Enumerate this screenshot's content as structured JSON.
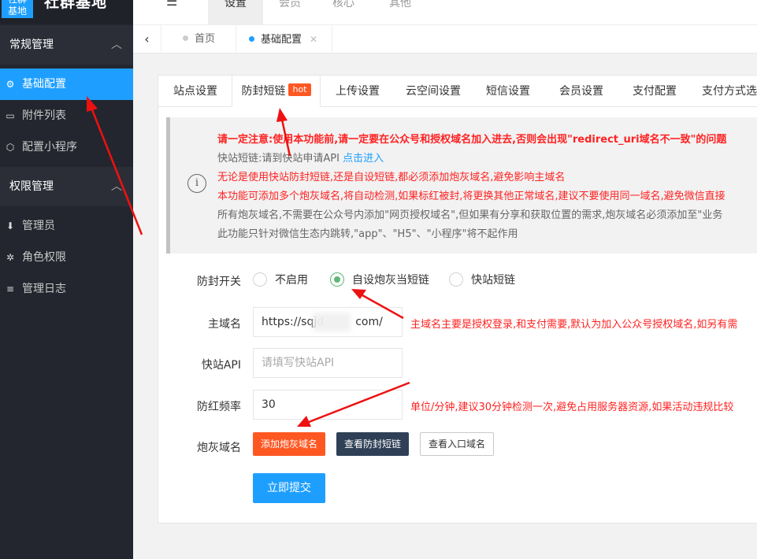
{
  "app": {
    "logo_badge_line1": "社群",
    "logo_badge_line2": "基地",
    "title": "社群基地"
  },
  "topbar": {
    "tabs": [
      {
        "label": "设置"
      },
      {
        "label": "会员"
      },
      {
        "label": "核心"
      },
      {
        "label": "其他"
      }
    ]
  },
  "sidebar": {
    "group1": "常规管理",
    "items1": [
      {
        "label": "基础配置"
      },
      {
        "label": "附件列表"
      },
      {
        "label": "配置小程序"
      }
    ],
    "group2": "权限管理",
    "items2": [
      {
        "label": "管理员"
      },
      {
        "label": "角色权限"
      },
      {
        "label": "管理日志"
      }
    ]
  },
  "pagetabs": [
    {
      "label": "首页"
    },
    {
      "label": "基础配置"
    }
  ],
  "form_tabs": [
    {
      "label": "站点设置"
    },
    {
      "label": "防封短链"
    },
    {
      "label": "上传设置"
    },
    {
      "label": "云空间设置"
    },
    {
      "label": "短信设置"
    },
    {
      "label": "会员设置"
    },
    {
      "label": "支付配置"
    },
    {
      "label": "支付方式选"
    }
  ],
  "hot_badge": "hot",
  "notice": {
    "line1": "请一定注意:使用本功能前,请一定要在公众号和授权域名加入进去,否则会出现\"redirect_uri域名不一致\"的问题",
    "line2_prefix": "快站短链:请到快站申请API ",
    "line2_link": "点击进入",
    "line3": "无论是使用快站防封短链,还是自设短链,都必须添加炮灰域名,避免影响主域名",
    "line4": "本功能可添加多个炮灰域名,将自动检测,如果标红被封,将更换其他正常域名,建议不要使用同一域名,避免微信直接",
    "line5": "所有炮灰域名,不需要在公众号内添加\"网页授权域名\",但如果有分享和获取位置的需求,炮灰域名必须添加至\"业务",
    "line6": "此功能只针对微信生态内跳转,\"app\"、\"H5\"、\"小程序\"将不起作用"
  },
  "form": {
    "switch_label": "防封开关",
    "radio_options": [
      {
        "label": "不启用",
        "checked": false
      },
      {
        "label": "自设炮灰当短链",
        "checked": true
      },
      {
        "label": "快站短链",
        "checked": false
      }
    ],
    "domain_label": "主域名",
    "domain_value": "https://sqjd         com/",
    "domain_tip": "主域名主要是授权登录,和支付需要,默认为加入公众号授权域名,如另有需",
    "api_label": "快站API",
    "api_placeholder": "请填写快站API",
    "freq_label": "防红频率",
    "freq_value": "30",
    "freq_tip": "单位/分钟,建议30分钟检测一次,避免占用服务器资源,如果活动违规比较",
    "cannon_label": "炮灰域名",
    "btn_add": "添加炮灰域名",
    "btn_view_links": "查看防封短链",
    "btn_view_entry": "查看入口域名",
    "btn_submit": "立即提交"
  },
  "colors": {
    "accent": "#1e9fff",
    "sidebar_bg": "#23262e",
    "danger": "#ff2222",
    "hot": "#ff5722",
    "dark_button": "#2f4056",
    "radio_on": "#5fb878"
  }
}
